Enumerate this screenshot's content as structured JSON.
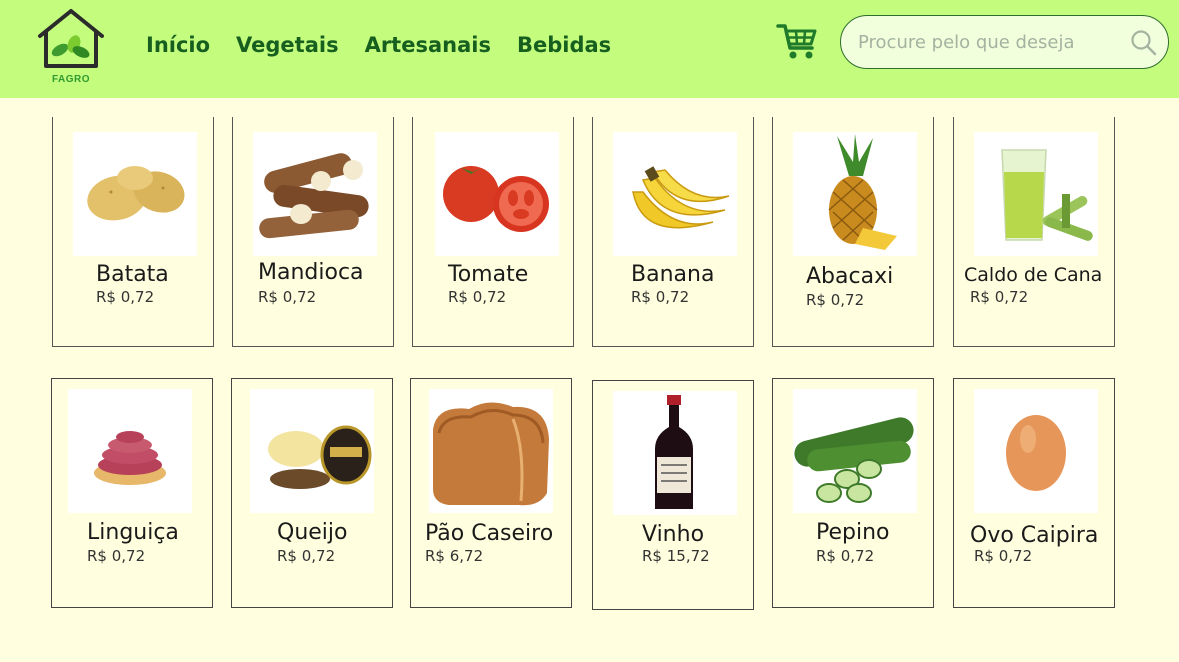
{
  "brand": {
    "name": "FAGRO",
    "accent": "#c4fd7e",
    "background": "#ffffdf",
    "nav_color": "#165f1e"
  },
  "nav": {
    "items": [
      {
        "label": "Início"
      },
      {
        "label": "Vegetais"
      },
      {
        "label": "Artesanais"
      },
      {
        "label": "Bebidas"
      }
    ]
  },
  "cart": {
    "icon": "shopping-cart-icon"
  },
  "search": {
    "placeholder": "Procure pelo que deseja",
    "value": "",
    "icon": "search-icon"
  },
  "products": [
    {
      "name": "Batata",
      "price": "R$ 0,72",
      "icon": "potato-image"
    },
    {
      "name": "Mandioca",
      "price": "R$ 0,72",
      "icon": "cassava-image"
    },
    {
      "name": "Tomate",
      "price": "R$ 0,72",
      "icon": "tomato-image"
    },
    {
      "name": "Banana",
      "price": "R$ 0,72",
      "icon": "banana-image"
    },
    {
      "name": "Abacaxi",
      "price": "R$ 0,72",
      "icon": "pineapple-image"
    },
    {
      "name": "Caldo de Cana",
      "price": "R$ 0,72",
      "icon": "sugarcane-juice-image"
    },
    {
      "name": "Linguiça",
      "price": "R$ 0,72",
      "icon": "sausage-image"
    },
    {
      "name": "Queijo",
      "price": "R$ 0,72",
      "icon": "cheese-image"
    },
    {
      "name": "Pão Caseiro",
      "price": "R$ 6,72",
      "icon": "bread-image"
    },
    {
      "name": "Vinho",
      "price": "R$ 15,72",
      "icon": "wine-bottle-image"
    },
    {
      "name": "Pepino",
      "price": "R$ 0,72",
      "icon": "cucumber-image"
    },
    {
      "name": "Ovo Caipira",
      "price": "R$ 0,72",
      "icon": "egg-image"
    }
  ]
}
